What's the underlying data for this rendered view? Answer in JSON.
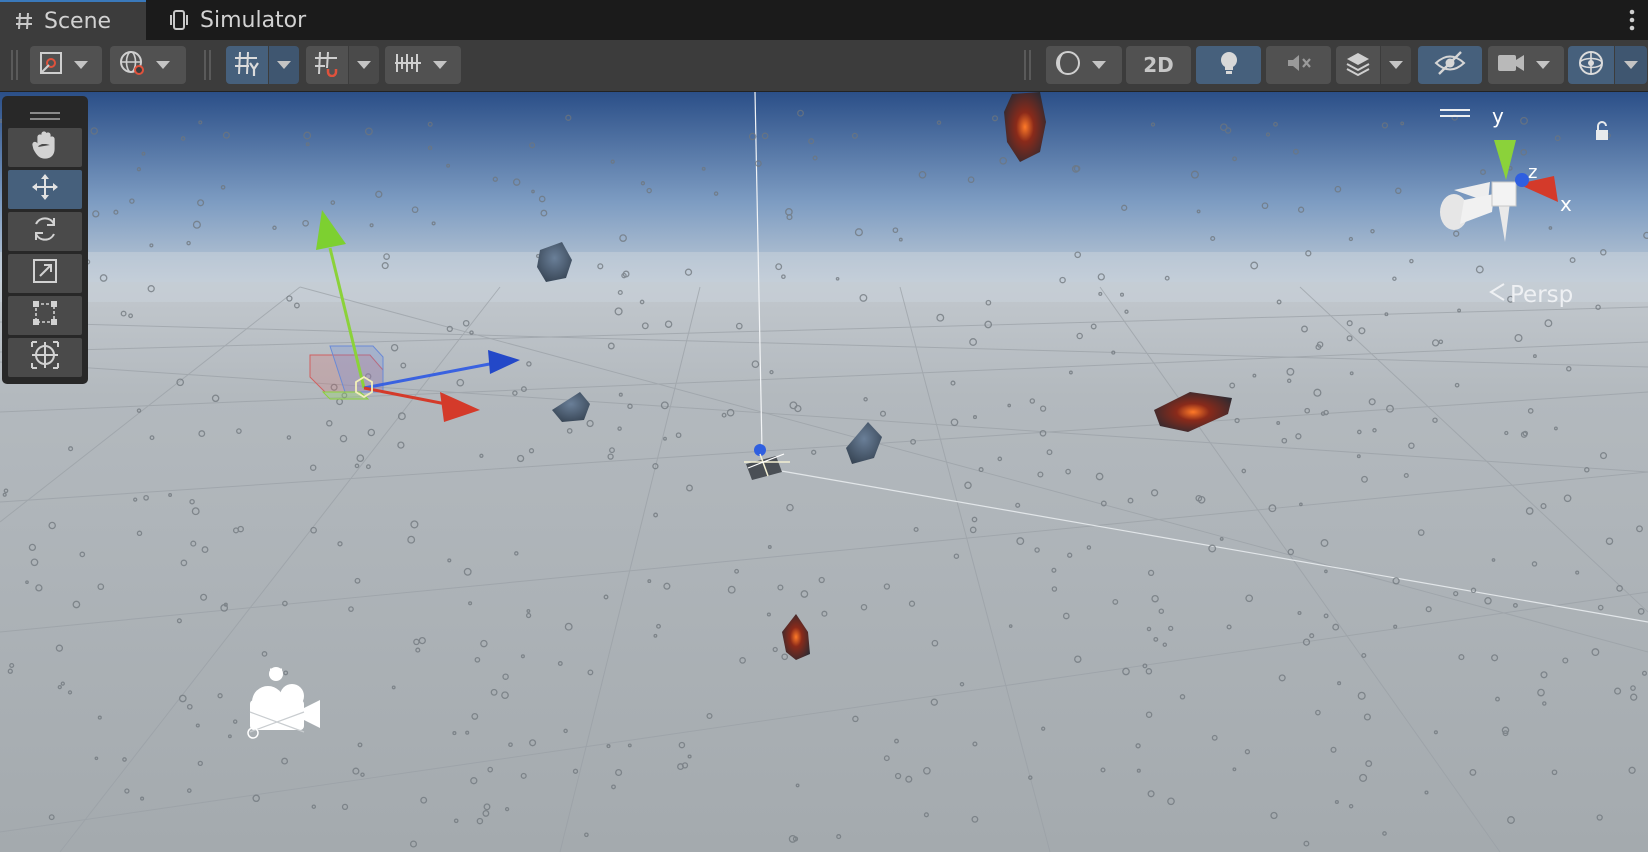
{
  "tabs": [
    {
      "id": "scene",
      "label": "Scene",
      "icon": "grid-hash-icon",
      "active": true
    },
    {
      "id": "simulator",
      "label": "Simulator",
      "icon": "device-simulator-icon",
      "active": false
    }
  ],
  "toolbar": {
    "left": [
      {
        "name": "draw-mode-button",
        "icon": "shaded-draw-mode-icon",
        "dropdown": true
      },
      {
        "name": "global-local-toggle",
        "icon": "globe-pivot-icon",
        "dropdown": true
      },
      {
        "name": "grid-visibility-toggle",
        "icon": "grid-y-icon",
        "dropdown": true,
        "active": true
      },
      {
        "name": "grid-snapping-toggle",
        "icon": "grid-snap-magnet-icon",
        "dropdown": true
      },
      {
        "name": "increment-snap-button",
        "icon": "ruler-increment-icon",
        "dropdown": true
      }
    ],
    "right": {
      "shading_icon": "shading-sphere-icon",
      "two_d_label": "2D",
      "lighting_icon": "lightbulb-icon",
      "audio_icon": "speaker-muted-icon",
      "effects_icon": "effects-layers-icon",
      "visibility_icon": "scene-visibility-eye-icon",
      "camera_icon": "scene-camera-icon",
      "gizmos_icon": "gizmos-sphere-icon"
    }
  },
  "tools": [
    {
      "id": "view",
      "icon": "hand-view-tool-icon",
      "active": false
    },
    {
      "id": "move",
      "icon": "move-arrows-tool-icon",
      "active": true
    },
    {
      "id": "rotate",
      "icon": "rotate-tool-icon",
      "active": false
    },
    {
      "id": "scale",
      "icon": "scale-tool-icon",
      "active": false
    },
    {
      "id": "rect",
      "icon": "rect-transform-tool-icon",
      "active": false
    },
    {
      "id": "transform",
      "icon": "transform-tool-icon",
      "active": false
    }
  ],
  "orientation_gizmo": {
    "axis_x": "x",
    "axis_y": "y",
    "axis_z": "z",
    "projection_label": "Persp",
    "colors": {
      "x": "#d43a2a",
      "y": "#8bd23a",
      "z": "#2f5fe0"
    }
  },
  "colors": {
    "sky_top": "#2b4f88",
    "horizon": "#c7d0d8",
    "ground": "#a8aeb3",
    "accent_blue": "#46607c"
  }
}
